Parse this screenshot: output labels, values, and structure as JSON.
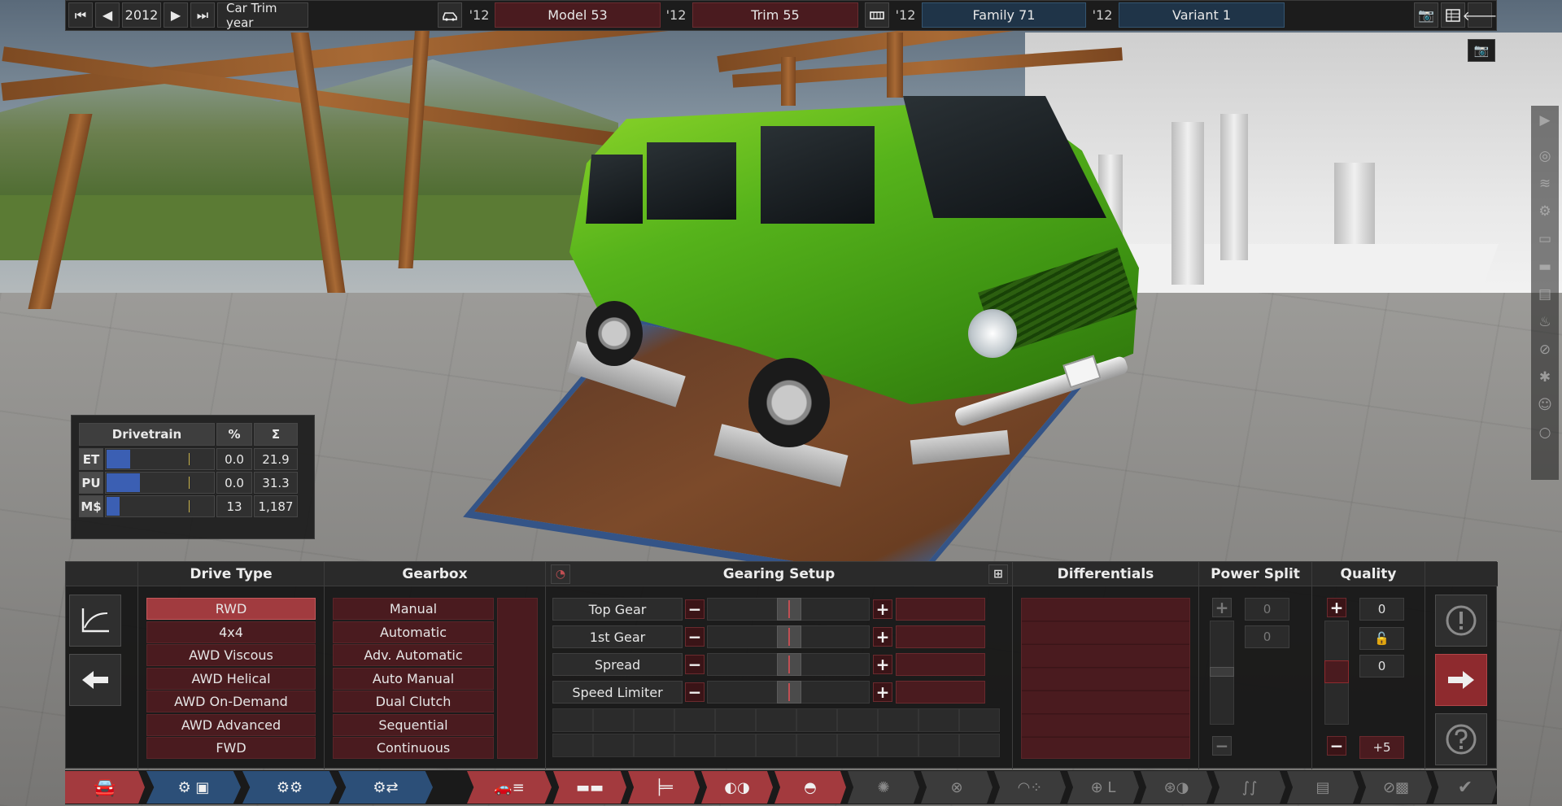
{
  "topbar": {
    "nav_first": "⏮",
    "nav_prev": "◀",
    "year": "2012",
    "nav_next": "▶",
    "nav_last": "⏭",
    "year_label": "Car Trim year",
    "model_year": "'12",
    "model": "Model 53",
    "trim_year": "'12",
    "trim": "Trim 55",
    "family_year": "'12",
    "family": "Family 71",
    "variant_year": "'12",
    "variant": "Variant 1"
  },
  "stats": {
    "headers": [
      "Drivetrain",
      "%",
      "Σ"
    ],
    "rows": [
      {
        "label": "ET",
        "pct": "0.0",
        "sum": "21.9",
        "fill": 0.22
      },
      {
        "label": "PU",
        "pct": "0.0",
        "sum": "31.3",
        "fill": 0.31
      },
      {
        "label": "M$",
        "pct": "13",
        "sum": "1,187",
        "fill": 0.12
      }
    ]
  },
  "panel": {
    "drive_type": {
      "title": "Drive Type",
      "options": [
        "RWD",
        "4x4",
        "AWD Viscous",
        "AWD Helical",
        "AWD On-Demand",
        "AWD Advanced",
        "FWD"
      ],
      "selected": 0
    },
    "gearbox": {
      "title": "Gearbox",
      "options": [
        "Manual",
        "Automatic",
        "Adv. Automatic",
        "Auto Manual",
        "Dual Clutch",
        "Sequential",
        "Continuous"
      ]
    },
    "gearing": {
      "title": "Gearing Setup",
      "rows": [
        {
          "label": "Top Gear",
          "level": 0.5
        },
        {
          "label": "1st Gear",
          "level": 0.5
        },
        {
          "label": "Spread",
          "level": 0.5
        },
        {
          "label": "Speed Limiter",
          "level": 0.5
        }
      ]
    },
    "differentials": {
      "title": "Differentials"
    },
    "power_split": {
      "title": "Power Split",
      "value1": "0",
      "value2": "0"
    },
    "quality": {
      "title": "Quality",
      "value1": "0",
      "value2": "0",
      "bonus": "+5"
    }
  },
  "colors": {
    "accent_red": "#a13b3f",
    "dark_red": "#4a1b1f",
    "nav_blue": "#2c4f78",
    "bar_blue": "#3b5fb3"
  }
}
